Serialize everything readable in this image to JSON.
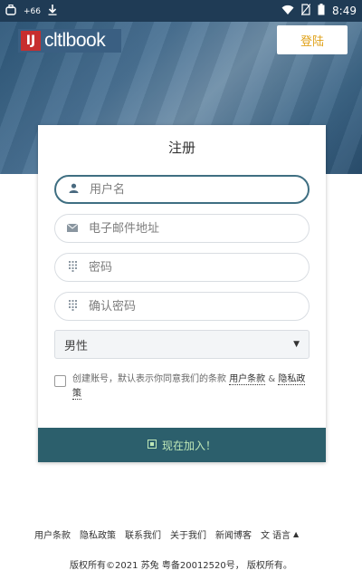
{
  "status_bar": {
    "time": "8:49",
    "left_badge": "+66",
    "icons": [
      "app-icon",
      "download-icon",
      "wifi-icon",
      "no-sim-icon",
      "battery-icon"
    ]
  },
  "header": {
    "logo_text": "cltlbook",
    "logo_mark": "IJ",
    "login_label": "登陆"
  },
  "form": {
    "title": "注册",
    "username_placeholder": "用户名",
    "email_placeholder": "电子邮件地址",
    "password_placeholder": "密码",
    "confirm_password_placeholder": "确认密码",
    "gender_selected": "男性",
    "terms_prefix": "创建账号，默认表示你同意我们的条款",
    "terms_link": "用户条款",
    "terms_and": "&",
    "privacy_link": "隐私政策",
    "join_label": "现在加入！"
  },
  "footer": {
    "links": [
      "用户条款",
      "隐私政策",
      "联系我们",
      "关于我们",
      "新闻博客"
    ],
    "language_label": "语言",
    "copyright": "版权所有©2021 苏兔 粤备20012520号， 版权所有。"
  },
  "colors": {
    "status_bar": "#1f3b55",
    "join_button": "#2c5f6c",
    "login_text": "#e0a21a"
  }
}
